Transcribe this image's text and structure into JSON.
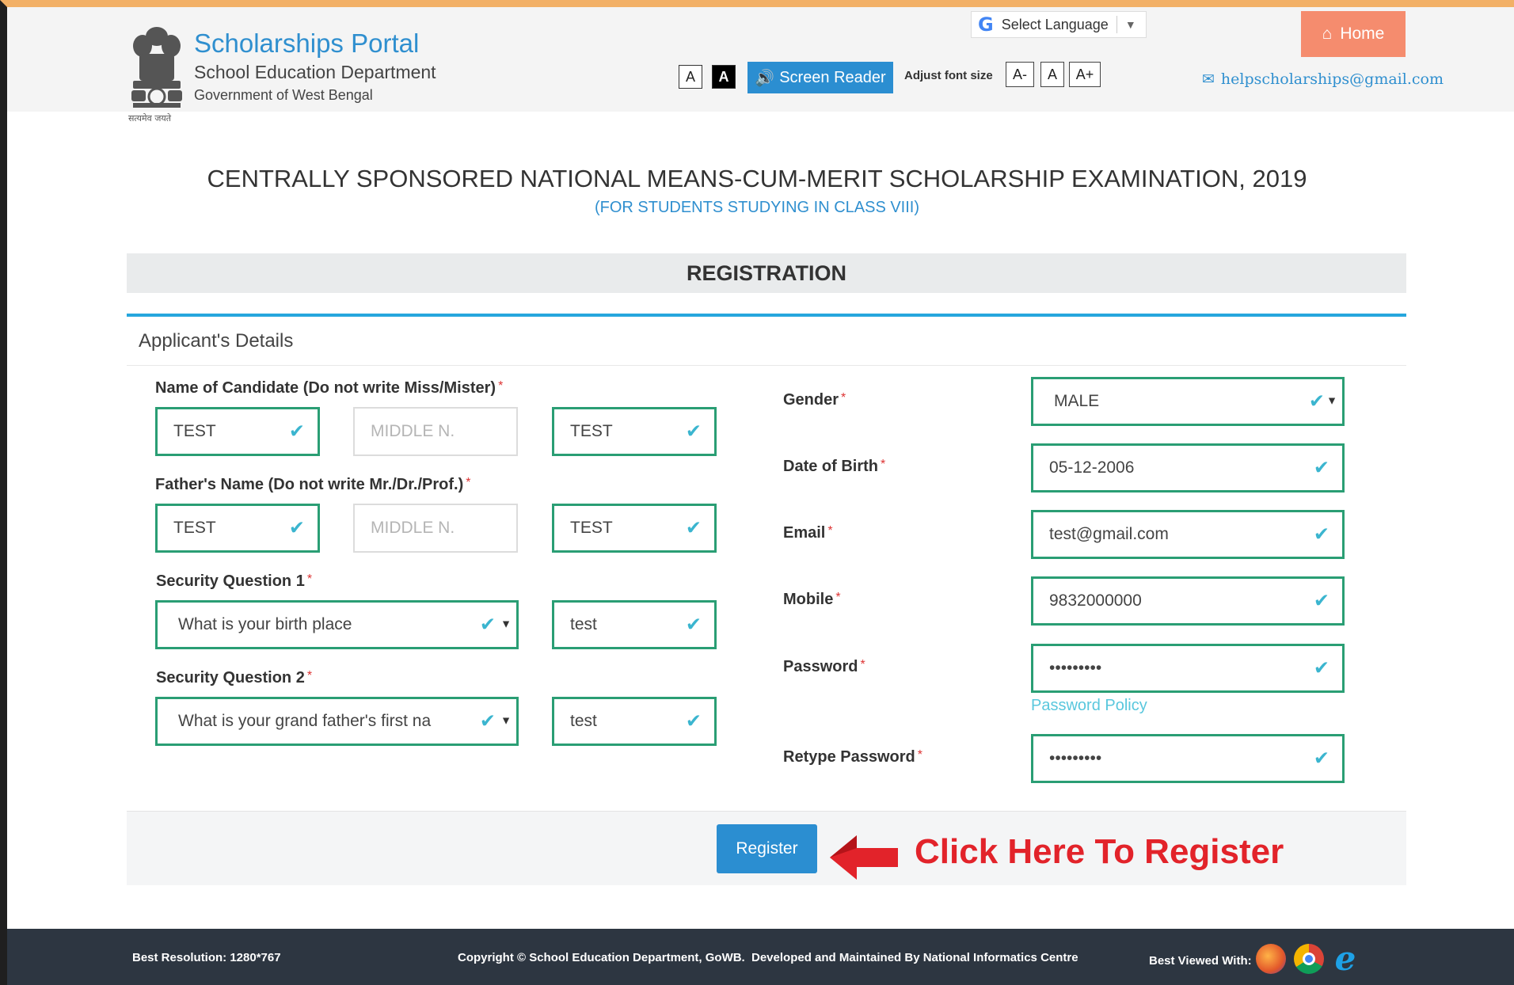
{
  "header": {
    "portal_title": "Scholarships Portal",
    "department": "School Education Department",
    "government": "Government of West Bengal",
    "emblem_caption": "सत्यमेव जयते",
    "language_select": "Select Language",
    "contrast_normal": "A",
    "contrast_dark": "A",
    "screen_reader": "Screen Reader",
    "adjust_font_label": "Adjust font size",
    "font_decrease": "A-",
    "font_normal": "A",
    "font_increase": "A+",
    "home": "Home",
    "help_email": "helpscholarships@gmail.com"
  },
  "exam": {
    "title": "CENTRALLY SPONSORED NATIONAL MEANS-CUM-MERIT SCHOLARSHIP EXAMINATION, 2019",
    "subtitle": "(FOR STUDENTS STUDYING IN CLASS VIII)"
  },
  "registration_heading": "REGISTRATION",
  "panel_heading": "Applicant's Details",
  "required_mark": "*",
  "left": {
    "candidate_label": "Name of Candidate (Do not write Miss/Mister)",
    "candidate_first": "TEST",
    "candidate_middle_placeholder": "MIDDLE N.",
    "candidate_last": "TEST",
    "father_label": "Father's Name (Do not write Mr./Dr./Prof.)",
    "father_first": "TEST",
    "father_middle_placeholder": "MIDDLE N.",
    "father_last": "TEST",
    "sq1_label": "Security Question 1",
    "sq1_question": "What is your birth place",
    "sq1_answer": "test",
    "sq2_label": "Security Question 2",
    "sq2_question": "What is your grand father's first na",
    "sq2_answer": "test"
  },
  "right": {
    "gender_label": "Gender",
    "gender_value": "MALE",
    "dob_label": "Date of Birth",
    "dob_value": "05-12-2006",
    "email_label": "Email",
    "email_value": "test@gmail.com",
    "mobile_label": "Mobile",
    "mobile_value": "9832000000",
    "password_label": "Password",
    "password_value": "•••••••••",
    "password_policy": "Password Policy",
    "retype_label": "Retype Password",
    "retype_value": "•••••••••"
  },
  "actions": {
    "register": "Register",
    "annotation": "Click Here To Register"
  },
  "footer": {
    "resolution": "Best Resolution: 1280*767",
    "copyright": "Copyright © School Education Department, GoWB.",
    "developed": "Developed and Maintained By National Informatics Centre",
    "best_viewed": "Best Viewed With:"
  },
  "colors": {
    "accent_blue": "#2b8ed1",
    "valid_green": "#2a9e74",
    "annotation_red": "#e2232a",
    "home_orange": "#f58c6e",
    "footer_dark": "#2d3641"
  },
  "icons": [
    "google-icon",
    "speaker-icon",
    "home-icon",
    "envelope-icon",
    "check-icon",
    "caret-down-icon",
    "firefox-icon",
    "chrome-icon",
    "ie-icon"
  ]
}
